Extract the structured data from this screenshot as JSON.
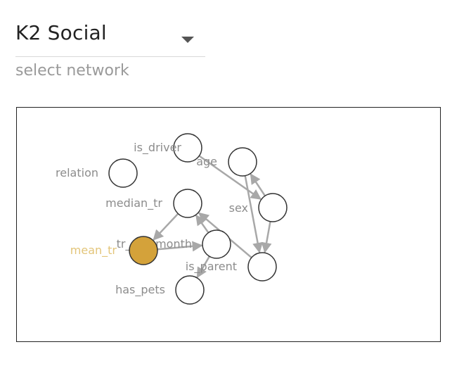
{
  "network_select": {
    "value": "K2 Social",
    "helper": "select network"
  },
  "colors": {
    "edge": "#a8a8a8",
    "node_stroke": "#333333",
    "node_fill": "#ffffff",
    "selected_fill": "#d4a23a",
    "selected_label": "#e3c57a",
    "label": "#8c8c8c"
  },
  "graph": {
    "selected_node": "mean_tr",
    "nodes": [
      {
        "id": "is_driver",
        "label": "is_driver"
      },
      {
        "id": "relation",
        "label": "relation"
      },
      {
        "id": "age",
        "label": "age"
      },
      {
        "id": "median_tr",
        "label": "median_tr"
      },
      {
        "id": "sex",
        "label": "sex"
      },
      {
        "id": "tr_per_month",
        "label": "tr_per_month"
      },
      {
        "id": "mean_tr",
        "label": "mean_tr"
      },
      {
        "id": "is_parent",
        "label": "is_parent"
      },
      {
        "id": "has_pets",
        "label": "has_pets"
      }
    ],
    "edges": [
      {
        "from": "is_driver",
        "to": "sex"
      },
      {
        "from": "sex",
        "to": "age"
      },
      {
        "from": "age",
        "to": "is_parent"
      },
      {
        "from": "sex",
        "to": "is_parent"
      },
      {
        "from": "median_tr",
        "to": "mean_tr"
      },
      {
        "from": "mean_tr",
        "to": "tr_per_month"
      },
      {
        "from": "tr_per_month",
        "to": "median_tr"
      },
      {
        "from": "is_parent",
        "to": "median_tr"
      },
      {
        "from": "tr_per_month",
        "to": "has_pets"
      }
    ]
  }
}
